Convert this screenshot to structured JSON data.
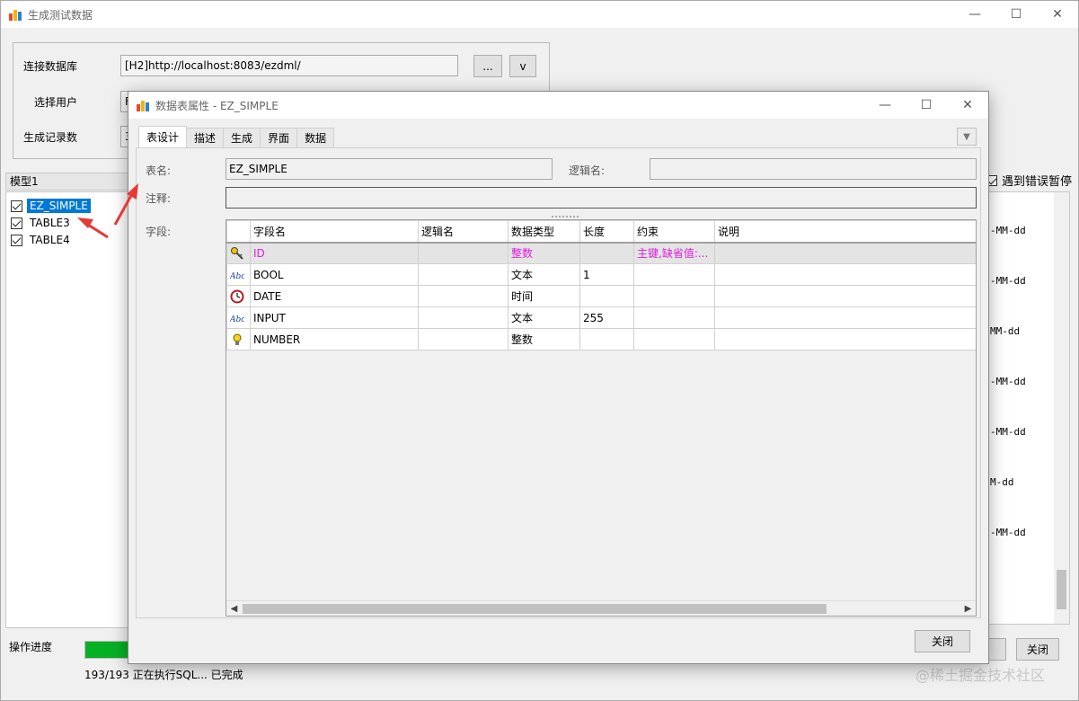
{
  "main": {
    "title": "生成测试数据",
    "conn": {
      "db_label": "连接数据库",
      "db_value": "[H2]http://localhost:8083/ezdml/",
      "browse_btn": "...",
      "drop_btn": "v",
      "user_label": "选择用户",
      "user_value": "F",
      "count_label": "生成记录数",
      "count_value": "3"
    },
    "model_header": "模型1",
    "tree": [
      {
        "label": "EZ_SIMPLE",
        "checked": true,
        "selected": true
      },
      {
        "label": "TABLE3",
        "checked": true,
        "selected": false
      },
      {
        "label": "TABLE4",
        "checked": true,
        "selected": false
      }
    ],
    "stop_on_error_label": "遇到错误暂停",
    "sql_lines": [
      "-MM-dd",
      "-MM-dd",
      "MM-dd",
      "-MM-dd",
      "-MM-dd",
      "M-dd",
      "-MM-dd"
    ],
    "progress_label": "操作进度",
    "progress_fraction": 1.0,
    "status": "193/193 正在执行SQL... 已完成",
    "close_btn": "关闭",
    "watermark": "@稀土掘金技术社区"
  },
  "dialog": {
    "title": "数据表属性 - EZ_SIMPLE",
    "tabs": [
      "表设计",
      "描述",
      "生成",
      "界面",
      "数据"
    ],
    "active_tab": 0,
    "table_name_label": "表名:",
    "table_name_value": "EZ_SIMPLE",
    "logic_name_label": "逻辑名:",
    "logic_name_value": "",
    "comment_label": "注释:",
    "comment_value": "",
    "fields_label": "字段:",
    "columns": [
      "字段名",
      "逻辑名",
      "数据类型",
      "长度",
      "约束",
      "说明"
    ],
    "rows": [
      {
        "icon": "key-icon",
        "name": "ID",
        "logic": "",
        "type": "整数",
        "length": "",
        "constraint": "主键,缺省值:...",
        "desc": "",
        "pk": true
      },
      {
        "icon": "abc-text-icon",
        "name": "BOOL",
        "logic": "",
        "type": "文本",
        "length": "1",
        "constraint": "",
        "desc": "",
        "pk": false
      },
      {
        "icon": "clock-icon",
        "name": "DATE",
        "logic": "",
        "type": "时间",
        "length": "",
        "constraint": "",
        "desc": "",
        "pk": false
      },
      {
        "icon": "abc-text-icon",
        "name": "INPUT",
        "logic": "",
        "type": "文本",
        "length": "255",
        "constraint": "",
        "desc": "",
        "pk": false
      },
      {
        "icon": "bulb-icon",
        "name": "NUMBER",
        "logic": "",
        "type": "整数",
        "length": "",
        "constraint": "",
        "desc": "",
        "pk": false
      }
    ],
    "close_btn": "关闭"
  },
  "colors": {
    "selection": "#0078d7",
    "pk_text": "#e01be0",
    "progress": "#06b025",
    "arrow": "#e53935"
  }
}
